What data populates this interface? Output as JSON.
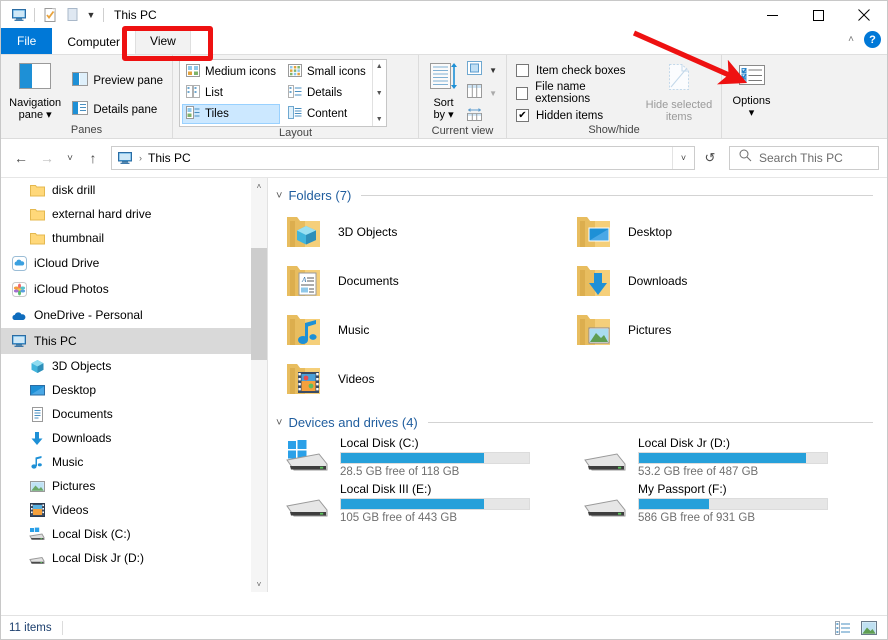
{
  "window": {
    "title": "This PC",
    "quick_access": [
      "this-pc-icon",
      "properties-icon",
      "new-folder-icon"
    ],
    "minimize_label": "—",
    "maximize_label": "□",
    "close_label": "✕",
    "ribbon_collapse_label": "˄",
    "help_label": "?"
  },
  "tabs": {
    "file": "File",
    "items": [
      {
        "label": "Computer",
        "active": false
      },
      {
        "label": "View",
        "active": true
      }
    ]
  },
  "ribbon": {
    "groups": [
      {
        "name": "panes",
        "label": "Panes",
        "big_button": {
          "line1": "Navigation",
          "line2": "pane ▾"
        },
        "small_buttons": [
          {
            "label": "Preview pane"
          },
          {
            "label": "Details pane"
          }
        ]
      },
      {
        "name": "layout",
        "label": "Layout",
        "gallery": [
          {
            "label": "Medium icons",
            "selected": false
          },
          {
            "label": "List",
            "selected": false
          },
          {
            "label": "Tiles",
            "selected": true
          },
          {
            "label": "Small icons",
            "selected": false
          },
          {
            "label": "Details",
            "selected": false
          },
          {
            "label": "Content",
            "selected": false
          }
        ]
      },
      {
        "name": "current-view",
        "label": "Current view",
        "sort_button": {
          "line1": "Sort",
          "line2": "by ▾"
        },
        "side_buttons": [
          "add-columns-icon",
          "size-all-columns-icon"
        ]
      },
      {
        "name": "show-hide",
        "label": "Show/hide",
        "checkboxes": [
          {
            "label": "Item check boxes",
            "checked": false
          },
          {
            "label": "File name extensions",
            "checked": false
          },
          {
            "label": "Hidden items",
            "checked": true
          }
        ],
        "hide_selected": {
          "line1": "Hide selected",
          "line2": "items"
        }
      },
      {
        "name": "options",
        "label": "",
        "options_button": {
          "line1": "Options",
          "line2": "▾"
        }
      }
    ]
  },
  "addressbar": {
    "back": "←",
    "forward": "→",
    "recent": "˅",
    "up": "↑",
    "crumb": "This PC",
    "separator": "›",
    "dropdown": "˅",
    "refresh": "↺"
  },
  "search": {
    "placeholder": "Search This PC",
    "icon": "search-icon"
  },
  "navpane": {
    "items": [
      {
        "label": "disk drill",
        "icon": "folder-icon",
        "indent": 1,
        "selected": false
      },
      {
        "label": "external hard drive",
        "icon": "folder-icon",
        "indent": 1,
        "selected": false
      },
      {
        "label": "thumbnail",
        "icon": "folder-icon",
        "indent": 1,
        "selected": false
      },
      {
        "label": "iCloud Drive",
        "icon": "icloud-drive-icon",
        "indent": 0,
        "selected": false
      },
      {
        "label": "iCloud Photos",
        "icon": "icloud-photos-icon",
        "indent": 0,
        "selected": false
      },
      {
        "label": "OneDrive - Personal",
        "icon": "onedrive-icon",
        "indent": 0,
        "selected": false
      },
      {
        "label": "This PC",
        "icon": "this-pc-icon",
        "indent": 0,
        "selected": true
      },
      {
        "label": "3D Objects",
        "icon": "3d-objects-icon",
        "indent": 1,
        "selected": false
      },
      {
        "label": "Desktop",
        "icon": "desktop-icon",
        "indent": 1,
        "selected": false
      },
      {
        "label": "Documents",
        "icon": "documents-icon",
        "indent": 1,
        "selected": false
      },
      {
        "label": "Downloads",
        "icon": "downloads-icon",
        "indent": 1,
        "selected": false
      },
      {
        "label": "Music",
        "icon": "music-icon",
        "indent": 1,
        "selected": false
      },
      {
        "label": "Pictures",
        "icon": "pictures-icon",
        "indent": 1,
        "selected": false
      },
      {
        "label": "Videos",
        "icon": "videos-icon",
        "indent": 1,
        "selected": false
      },
      {
        "label": "Local Disk (C:)",
        "icon": "windows-drive-icon",
        "indent": 1,
        "selected": false
      },
      {
        "label": "Local Disk Jr (D:)",
        "icon": "drive-icon",
        "indent": 1,
        "selected": false
      }
    ],
    "scroll_up": "˄",
    "scroll_down": "˅"
  },
  "content": {
    "groups": [
      {
        "name": "folders",
        "title": "Folders (7)",
        "chevron": "˅",
        "items": [
          {
            "label": "3D Objects",
            "icon": "folder-3d-objects-icon"
          },
          {
            "label": "Desktop",
            "icon": "folder-desktop-icon"
          },
          {
            "label": "Documents",
            "icon": "folder-documents-icon"
          },
          {
            "label": "Downloads",
            "icon": "folder-downloads-icon"
          },
          {
            "label": "Music",
            "icon": "folder-music-icon"
          },
          {
            "label": "Pictures",
            "icon": "folder-pictures-icon"
          },
          {
            "label": "Videos",
            "icon": "folder-videos-icon"
          }
        ]
      },
      {
        "name": "devices-and-drives",
        "title": "Devices and drives (4)",
        "chevron": "˅",
        "drives": [
          {
            "name": "Local Disk (C:)",
            "free": "28.5 GB free of 118 GB",
            "used_pct": 76,
            "icon": "windows-drive-icon"
          },
          {
            "name": "Local Disk Jr (D:)",
            "free": "53.2 GB free of 487 GB",
            "used_pct": 89,
            "icon": "drive-icon"
          },
          {
            "name": "Local Disk III (E:)",
            "free": "105 GB free of 443 GB",
            "used_pct": 76,
            "icon": "drive-icon"
          },
          {
            "name": "My Passport (F:)",
            "free": "586 GB free of 931 GB",
            "used_pct": 37,
            "icon": "drive-icon"
          }
        ]
      }
    ]
  },
  "statusbar": {
    "items_text": "11 items",
    "view_details_icon": "details-view-icon",
    "view_large_icons_icon": "large-icons-view-icon"
  },
  "annotations": {
    "highlight_rect": {
      "target": "View tab",
      "color": "#ee1111"
    },
    "arrow": {
      "target": "Options button",
      "color": "#ee1111"
    }
  },
  "colors": {
    "accent": "#0078d7",
    "progress": "#26a0da",
    "annotation": "#ee1111",
    "group_title": "#1f5d9e"
  }
}
